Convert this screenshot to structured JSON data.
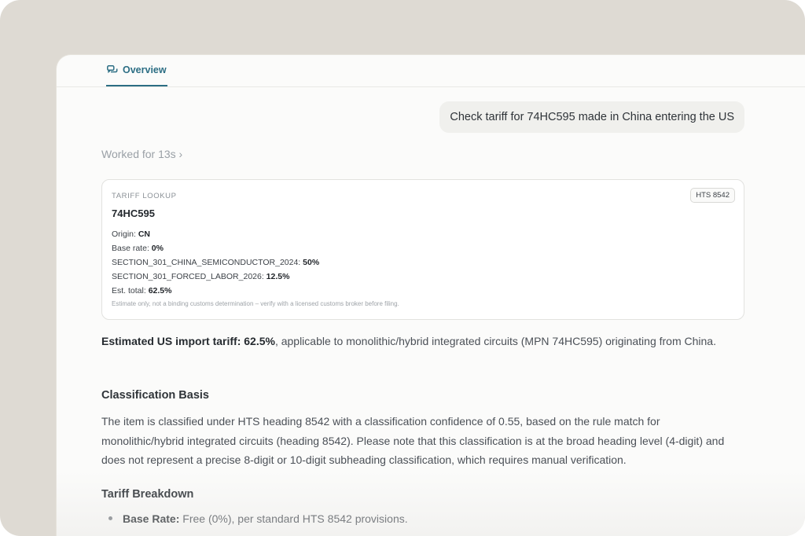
{
  "tabs": [
    {
      "label": "Overview",
      "icon": "chat-bubbles-icon",
      "active": true
    }
  ],
  "user_message": "Check tariff for 74HC595 made in China entering the US",
  "worked_for": "Worked for 13s ›",
  "card": {
    "label": "TARIFF LOOKUP",
    "badge": "HTS 8542",
    "part": "74HC595",
    "rows": [
      {
        "key": "Origin: ",
        "value": "CN"
      },
      {
        "key": "Base rate: ",
        "value": "0%"
      },
      {
        "key": "SECTION_301_CHINA_SEMICONDUCTOR_2024: ",
        "value": "50%"
      },
      {
        "key": "SECTION_301_FORCED_LABOR_2026: ",
        "value": "12.5%"
      },
      {
        "key": "Est. total: ",
        "value": "62.5%"
      }
    ],
    "note": "Estimate only, not a binding customs determination – verify with a licensed customs broker before filing."
  },
  "answer": {
    "bold": "Estimated US import tariff: 62.5%",
    "rest": ", applicable to monolithic/hybrid integrated circuits (MPN 74HC595) originating from China."
  },
  "classification": {
    "heading": "Classification Basis",
    "text": "The item is classified under HTS heading 8542 with a classification confidence of 0.55, based on the rule match for monolithic/hybrid integrated circuits (heading 8542). Please note that this classification is at the broad heading level (4-digit) and does not represent a precise 8-digit or 10-digit subheading classification, which requires manual verification."
  },
  "breakdown": {
    "heading": "Tariff Breakdown",
    "items": [
      {
        "bold": "Base Rate:",
        "rest": " Free (0%), per standard HTS 8542 provisions."
      }
    ]
  },
  "colors": {
    "accent": "#2c6e84",
    "frame": "#dedad3",
    "panel": "#fbfbfa"
  }
}
